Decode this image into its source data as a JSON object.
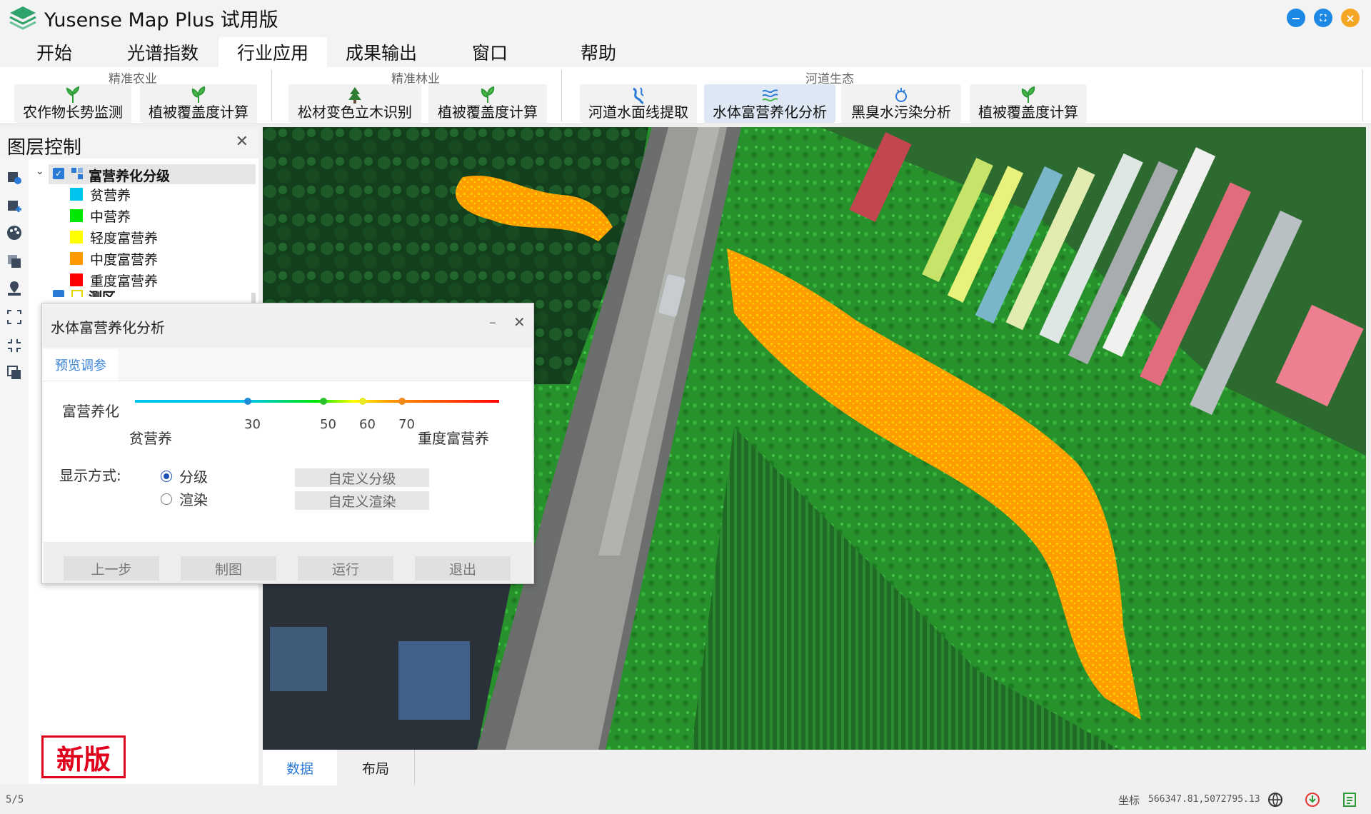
{
  "window": {
    "title": "Yusense Map Plus 试用版"
  },
  "menu": {
    "tabs": [
      "开始",
      "光谱指数",
      "行业应用",
      "成果输出",
      "窗口",
      "帮助"
    ],
    "active_tab": "行业应用"
  },
  "ribbon": {
    "groups": [
      {
        "label": "精准农业",
        "buttons": [
          "农作物长势监测",
          "植被覆盖度计算"
        ]
      },
      {
        "label": "精准林业",
        "buttons": [
          "松材变色立木识别",
          "植被覆盖度计算"
        ]
      },
      {
        "label": "河道生态",
        "buttons": [
          "河道水面线提取",
          "水体富营养化分析",
          "黑臭水污染分析",
          "植被覆盖度计算"
        ]
      }
    ],
    "active_button": "水体富营养化分析"
  },
  "layer_panel": {
    "title": "图层控制",
    "root_layer": "富营养化分级",
    "legend": [
      {
        "label": "贫营养",
        "color": "#00c4f0"
      },
      {
        "label": "中营养",
        "color": "#00e600"
      },
      {
        "label": "轻度富营养",
        "color": "#ffff00"
      },
      {
        "label": "中度富营养",
        "color": "#ff9900"
      },
      {
        "label": "重度富营养",
        "color": "#ff0000"
      }
    ],
    "second_layer": "测区"
  },
  "badge": {
    "text": "新版"
  },
  "dialog": {
    "title": "水体富营养化分析",
    "tab": "预览调参",
    "trophic_label": "富营养化",
    "low_label": "贫营养",
    "high_label": "重度富营养",
    "thresholds": [
      30,
      50,
      60,
      70
    ],
    "display_label": "显示方式:",
    "display_options": [
      {
        "label": "分级",
        "checked": true
      },
      {
        "label": "渲染",
        "checked": false
      }
    ],
    "custom_buttons": [
      "自定义分级",
      "自定义渲染"
    ],
    "footer_buttons": [
      "上一步",
      "制图",
      "运行",
      "退出"
    ]
  },
  "view_tabs": {
    "items": [
      "数据",
      "布局"
    ],
    "active": "数据"
  },
  "status": {
    "page": "5/5",
    "coord_label": "坐标",
    "coord_value": "566347.81,5072795.13"
  },
  "colors": {
    "accent": "#2b7bd6",
    "badge": "#e0001b",
    "water": "#ff9a00"
  }
}
